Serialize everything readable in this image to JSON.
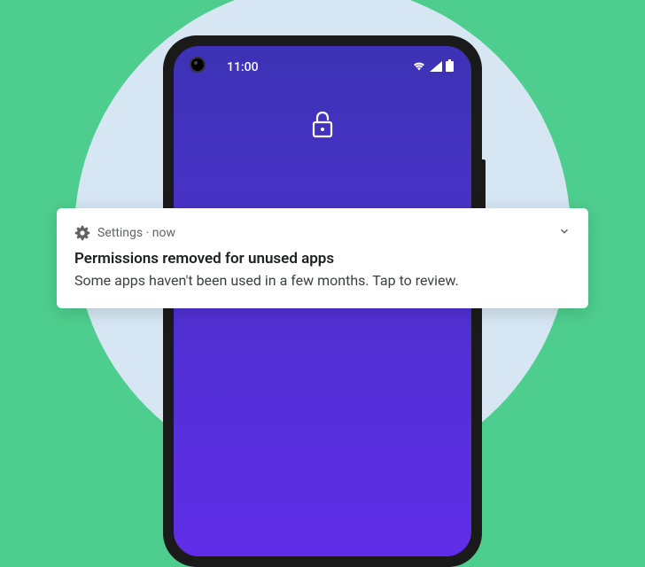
{
  "status_bar": {
    "time": "11:00"
  },
  "notification": {
    "app_name": "Settings",
    "separator": " · ",
    "timestamp": "now",
    "title": "Permissions removed for unused apps",
    "body": "Some apps haven't been used in a few months. Tap to review."
  }
}
